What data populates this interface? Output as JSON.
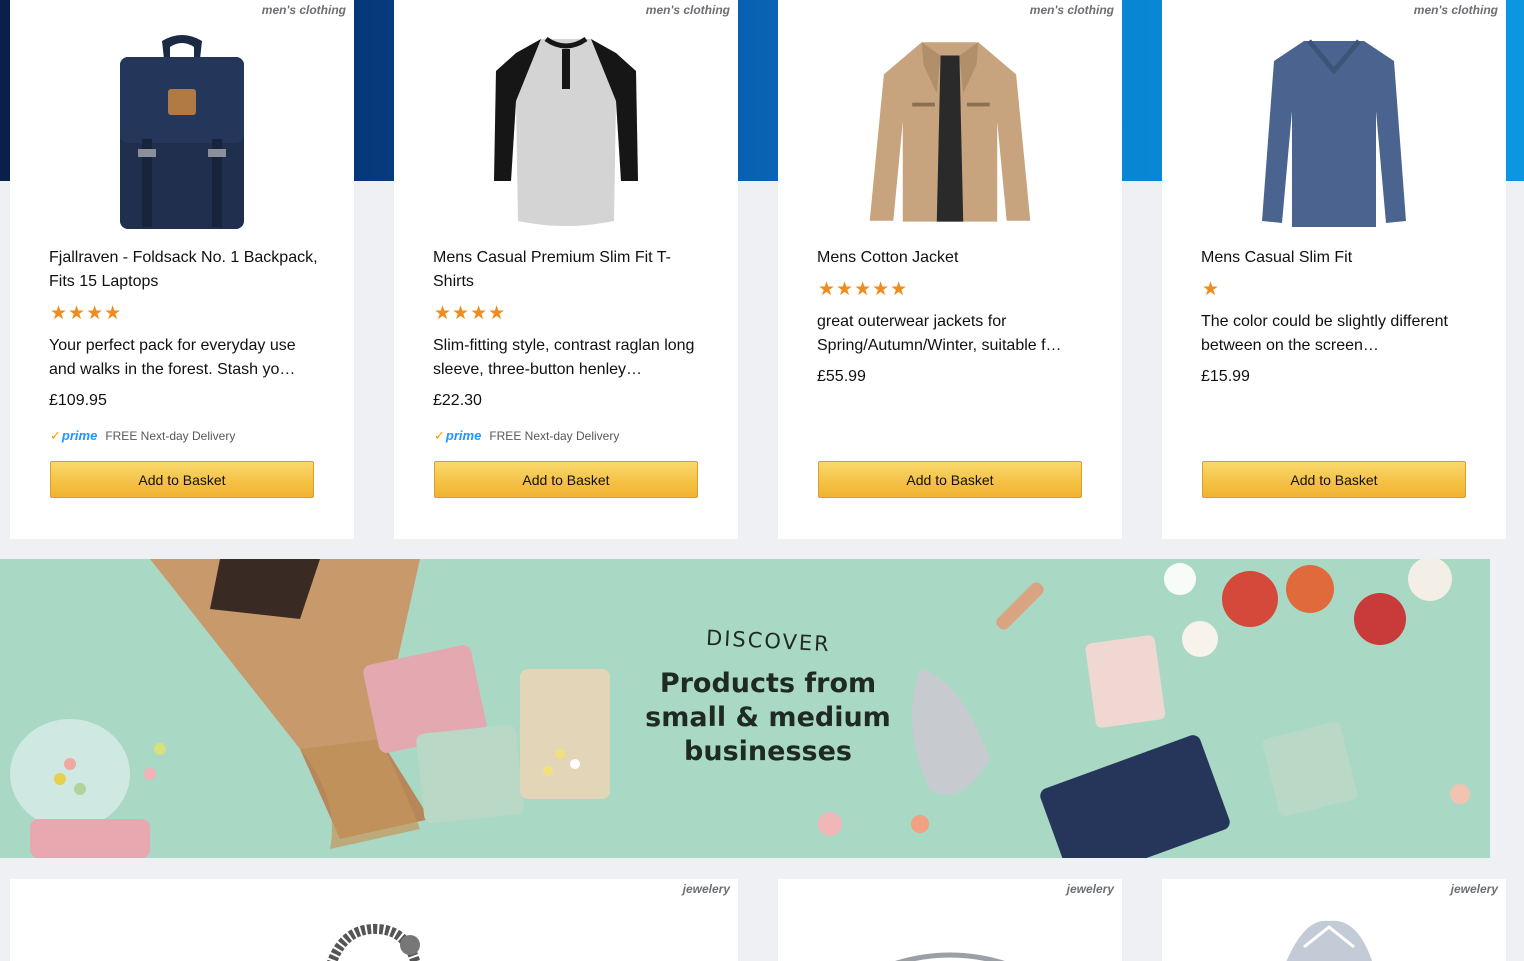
{
  "products": [
    {
      "category": "men's clothing",
      "title": "Fjallraven - Foldsack No. 1 Backpack, Fits 15 Laptops",
      "stars": "★★★★",
      "description": "Your perfect pack for everyday use and walks in the forest. Stash yo…",
      "price": "£109.95",
      "prime": true,
      "prime_label": "prime",
      "delivery": "FREE Next-day Delivery",
      "button": "Add to Basket",
      "image_icon": "backpack-image"
    },
    {
      "category": "men's clothing",
      "title": "Mens Casual Premium Slim Fit T-Shirts",
      "stars": "★★★★",
      "description": "Slim-fitting style, contrast raglan long sleeve, three-button henley…",
      "price": "£22.30",
      "prime": true,
      "prime_label": "prime",
      "delivery": "FREE Next-day Delivery",
      "button": "Add to Basket",
      "image_icon": "tshirt-image"
    },
    {
      "category": "men's clothing",
      "title": "Mens Cotton Jacket",
      "stars": "★★★★★",
      "description": "great outerwear jackets for Spring/Autumn/Winter, suitable f…",
      "price": "£55.99",
      "prime": false,
      "button": "Add to Basket",
      "image_icon": "jacket-image"
    },
    {
      "category": "men's clothing",
      "title": "Mens Casual Slim Fit",
      "stars": "★",
      "description": "The color could be slightly different between on the screen…",
      "price": "£15.99",
      "prime": false,
      "button": "Add to Basket",
      "image_icon": "sweater-image"
    }
  ],
  "banner": {
    "kicker": "DISCOVER",
    "line1": "Products from",
    "line2": "small & medium",
    "line3": "businesses"
  },
  "bottom_products": [
    {
      "category": "jewelery"
    },
    {
      "category": "jewelery"
    },
    {
      "category": "jewelery"
    }
  ],
  "colors": {
    "star": "#f08c1e",
    "button": "#f5c043",
    "banner_bg": "#a9d9c4"
  }
}
